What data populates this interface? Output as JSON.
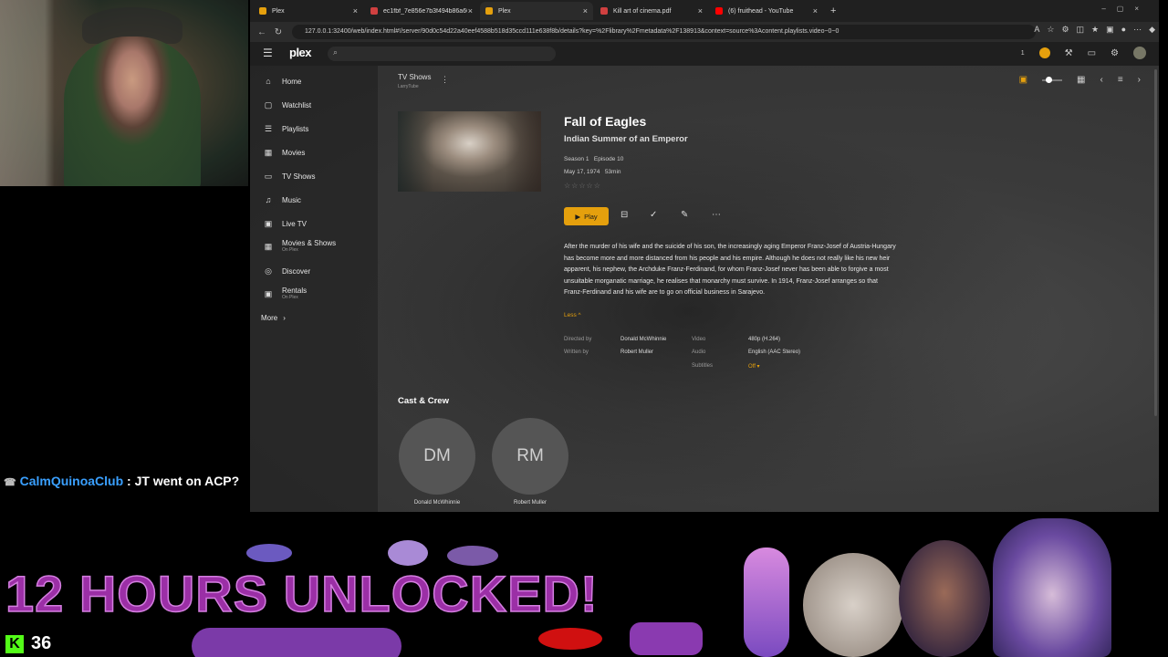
{
  "browser": {
    "tabs": [
      {
        "label": "Plex",
        "color": "#e5a00d"
      },
      {
        "label": "ec1fbf_7e856e7b3f494b86a668...",
        "color": "#d04040"
      },
      {
        "label": "Plex",
        "color": "#e5a00d"
      },
      {
        "label": "Kill art of cinema.pdf",
        "color": "#d04040"
      },
      {
        "label": "(6) fruithead - YouTube",
        "color": "#ff0000"
      }
    ],
    "new_tab": "+",
    "url": "127.0.0.1:32400/web/index.html#!/server/90d0c54d22a40eef4588b518d35ccd111e638f8b/details?key=%2Flibrary%2Fmetadata%2F138913&context=source%3Acontent.playlists.video~0~0"
  },
  "plex": {
    "logo_main": "plex",
    "notif_count": "1",
    "sidebar": {
      "items": [
        {
          "label": "Home",
          "icon": "home-icon",
          "glyph": "⌂"
        },
        {
          "label": "Watchlist",
          "icon": "watchlist-icon",
          "glyph": "▢"
        },
        {
          "label": "Playlists",
          "icon": "playlists-icon",
          "glyph": "☰"
        },
        {
          "label": "Movies",
          "icon": "movies-icon",
          "glyph": "▦"
        },
        {
          "label": "TV Shows",
          "icon": "tv-icon",
          "glyph": "▭"
        },
        {
          "label": "Music",
          "icon": "music-icon",
          "glyph": "♫"
        },
        {
          "label": "Live TV",
          "icon": "livetv-icon",
          "glyph": "▣"
        },
        {
          "label": "Movies & Shows",
          "sub": "On Plex",
          "icon": "film-icon",
          "glyph": "▦"
        },
        {
          "label": "Discover",
          "icon": "discover-icon",
          "glyph": "◎"
        },
        {
          "label": "Rentals",
          "sub": "On Plex",
          "icon": "rentals-icon",
          "glyph": "▣"
        }
      ],
      "more_label": "More"
    },
    "breadcrumb": {
      "title": "TV Shows",
      "sub": "LarryTube"
    },
    "episode": {
      "show_title": "Fall of Eagles",
      "episode_title": "Indian Summer of an Emperor",
      "season": "Season 1",
      "episode": "Episode 10",
      "date": "May 17, 1974",
      "duration": "53min",
      "rating_stars": "☆☆☆☆☆",
      "play_label": "Play",
      "summary": "After the murder of his wife and the suicide of his son, the increasingly aging Emperor Franz-Josef of Austria-Hungary has become more and more distanced from his people and his empire. Although he does not really like his new heir apparent, his nephew, the Archduke Franz-Ferdinand, for whom Franz-Josef never has been able to forgive a most unsuitable morganatic marriage, he realises that monarchy must survive. In 1914, Franz-Josef arranges so that Franz-Ferdinand and his wife are to go on official business in Sarajevo.",
      "less_label": "Less ^",
      "directed_label": "Directed by",
      "director": "Donald McWhinnie",
      "written_label": "Written by",
      "writer": "Robert Muller",
      "video_label": "Video",
      "video": "480p (H.264)",
      "audio_label": "Audio",
      "audio": "English (AAC Stereo)",
      "subtitles_label": "Subtitles",
      "subtitles": "Off ▾"
    },
    "cast": {
      "title": "Cast & Crew",
      "people": [
        {
          "initials": "DM",
          "name": "Donald McWhinnie"
        },
        {
          "initials": "RM",
          "name": "Robert Muller"
        }
      ]
    }
  },
  "chat": {
    "user": "CalmQuinoaClub",
    "message": " : JT went on ACP?"
  },
  "overlay": {
    "banner": "12 HOURS UNLOCKED!",
    "kick_logo": "K",
    "viewer_count": "36"
  }
}
